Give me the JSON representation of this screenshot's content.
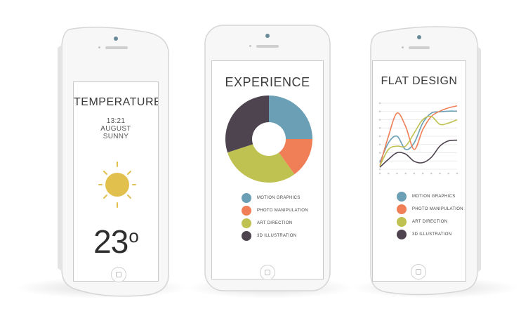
{
  "colors": {
    "blue": "#6a9fb5",
    "orange": "#f07f58",
    "olive": "#bfc150",
    "plum": "#4e444f",
    "sun": "#e2c04e"
  },
  "temperature": {
    "title": "TEMPERATURE",
    "time": "13:21",
    "date": "AUGUST",
    "condition": "SUNNY",
    "value": "23",
    "unit_symbol": "o",
    "icon": "sun-icon"
  },
  "experience": {
    "title": "EXPERIENCE",
    "legend": [
      {
        "label": "MOTION GRAPHICS",
        "color": "#6a9fb5"
      },
      {
        "label": "PHOTO MANIPULATION",
        "color": "#f07f58"
      },
      {
        "label": "ART DIRECTION",
        "color": "#bfc150"
      },
      {
        "label": "3D ILLUSTRATION",
        "color": "#4e444f"
      }
    ]
  },
  "flat_design": {
    "title": "FLAT DESIGN",
    "legend": [
      {
        "label": "MOTION GRAPHICS",
        "color": "#6a9fb5"
      },
      {
        "label": "PHOTO MANIPULATION",
        "color": "#f07f58"
      },
      {
        "label": "ART DIRECTION",
        "color": "#bfc150"
      },
      {
        "label": "3D ILLUSTRATION",
        "color": "#4e444f"
      }
    ]
  },
  "chart_data": [
    {
      "type": "pie",
      "title": "EXPERIENCE",
      "categories": [
        "MOTION GRAPHICS",
        "PHOTO MANIPULATION",
        "ART DIRECTION",
        "3D ILLUSTRATION"
      ],
      "values": [
        25,
        15,
        30,
        30
      ],
      "colors": [
        "#6a9fb5",
        "#f07f58",
        "#bfc150",
        "#4e444f"
      ],
      "donut": true
    },
    {
      "type": "line",
      "title": "FLAT DESIGN",
      "x": [
        0,
        1,
        2,
        3,
        4,
        5,
        6,
        7,
        8,
        9
      ],
      "series": [
        {
          "name": "MOTION GRAPHICS",
          "color": "#6a9fb5",
          "values": [
            1,
            4,
            5,
            3,
            4,
            7,
            8.5,
            8.7,
            8.8,
            8.8
          ]
        },
        {
          "name": "PHOTO MANIPULATION",
          "color": "#f07f58",
          "values": [
            0.5,
            5,
            8.5,
            6.5,
            3,
            6,
            8,
            8.8,
            9.3,
            9.6
          ]
        },
        {
          "name": "ART DIRECTION",
          "color": "#bfc150",
          "values": [
            0.5,
            3,
            3.5,
            3.5,
            5.5,
            7.5,
            8,
            6.8,
            7,
            7.5
          ]
        },
        {
          "name": "3D ILLUSTRATION",
          "color": "#4e444f",
          "values": [
            0.3,
            1.5,
            2.5,
            2.3,
            1.2,
            1.0,
            1.8,
            3.5,
            4.3,
            4.4
          ]
        }
      ],
      "ylim": [
        0,
        10
      ],
      "grid": true
    }
  ]
}
